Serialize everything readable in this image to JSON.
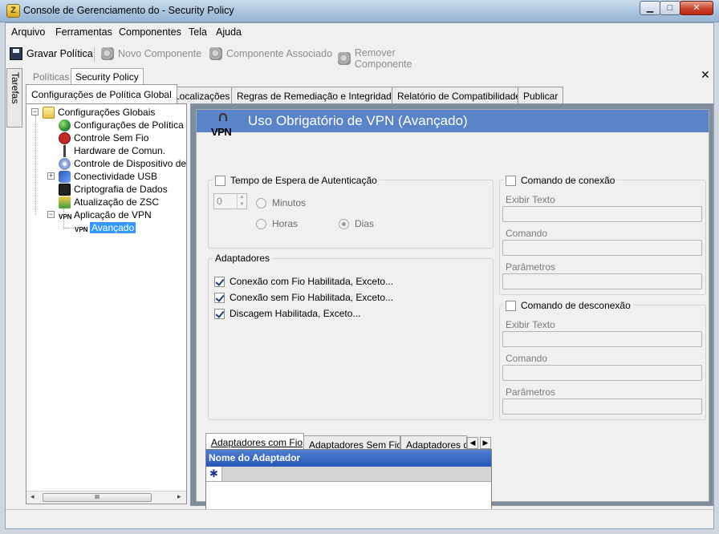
{
  "window": {
    "title": "Console de Gerenciamento do  - Security Policy",
    "app_icon_glyph": "Z",
    "buttons": {
      "minimize": "▁",
      "maximize": "□",
      "close": "✕"
    }
  },
  "menu": {
    "items": [
      "Arquivo",
      "Ferramentas",
      "Componentes",
      "Tela",
      "Ajuda"
    ]
  },
  "toolbar": {
    "save_label": "Gravar Política",
    "new_component_label": "Novo Componente",
    "associated_component_label": "Componente Associado",
    "remove_component_label": "Remover Componente"
  },
  "side_tab": {
    "label": "Tarefas"
  },
  "upper_tabs": [
    {
      "label": "Políticas",
      "active": false
    },
    {
      "label": "Security Policy",
      "active": true
    }
  ],
  "close_glyph": "✕",
  "main_tabs": [
    {
      "label": "Configurações de Política Global",
      "active": true
    },
    {
      "label": "Localizações",
      "active": false
    },
    {
      "label": "Regras de Remediação e Integridade",
      "active": false
    },
    {
      "label": "Relatório de Compatibilidade",
      "active": false
    },
    {
      "label": "Publicar",
      "active": false
    }
  ],
  "tree": {
    "root": {
      "label": "Configurações Globais",
      "expander": "−"
    },
    "items": [
      {
        "label": "Configurações de Política"
      },
      {
        "label": "Controle Sem Fio"
      },
      {
        "label": "Hardware de Comun."
      },
      {
        "label": "Controle de Dispositivo de"
      },
      {
        "label": "Conectividade USB",
        "expander": "+"
      },
      {
        "label": "Criptografia de Dados"
      },
      {
        "label": "Atualização de ZSC"
      },
      {
        "label": "Aplicação de VPN",
        "expander": "−"
      }
    ],
    "child": {
      "label": "Avançado",
      "selected": true
    },
    "scroll": {
      "left": "◂",
      "right": "▸",
      "thumb": "III"
    }
  },
  "panel": {
    "title": "Uso Obrigatório de VPN (Avançado)",
    "badge": "VPN",
    "auth_wait": {
      "label": "Tempo de Espera de Autenticação",
      "checked": false,
      "spin_value": "0",
      "spin_up": "▲",
      "spin_down": "▼",
      "minutes": "Minutos",
      "hours": "Horas",
      "days": "Dias"
    },
    "adapters": {
      "title": "Adaptadores",
      "items": [
        {
          "label": "Conexão com Fio Habilitada, Exceto...",
          "checked": true
        },
        {
          "label": "Conexão sem Fio Habilitada, Exceto...",
          "checked": true
        },
        {
          "label": "Discagem Habilitada, Exceto...",
          "checked": true
        }
      ]
    },
    "connect_command": {
      "label": "Comando de conexão",
      "checked": false,
      "display_text": "Exibir Texto",
      "command": "Comando",
      "parameters": "Parâmetros"
    },
    "disconnect_command": {
      "label": "Comando de desconexão",
      "checked": false,
      "display_text": "Exibir Texto",
      "command": "Comando",
      "parameters": "Parâmetros"
    },
    "lower_tabs": [
      {
        "label": "Adaptadores com Fio",
        "active": true
      },
      {
        "label": "Adaptadores Sem Fio",
        "active": false
      },
      {
        "label": "Adaptadores de",
        "active": false
      }
    ],
    "nav": {
      "prev": "◀",
      "next": "▶"
    },
    "grid": {
      "header": "Nome do Adaptador",
      "new_row_glyph": "✱"
    }
  },
  "colors": {
    "banner": "#5b84c8",
    "selection": "#3399ff",
    "grid_header": "#2857b8"
  }
}
